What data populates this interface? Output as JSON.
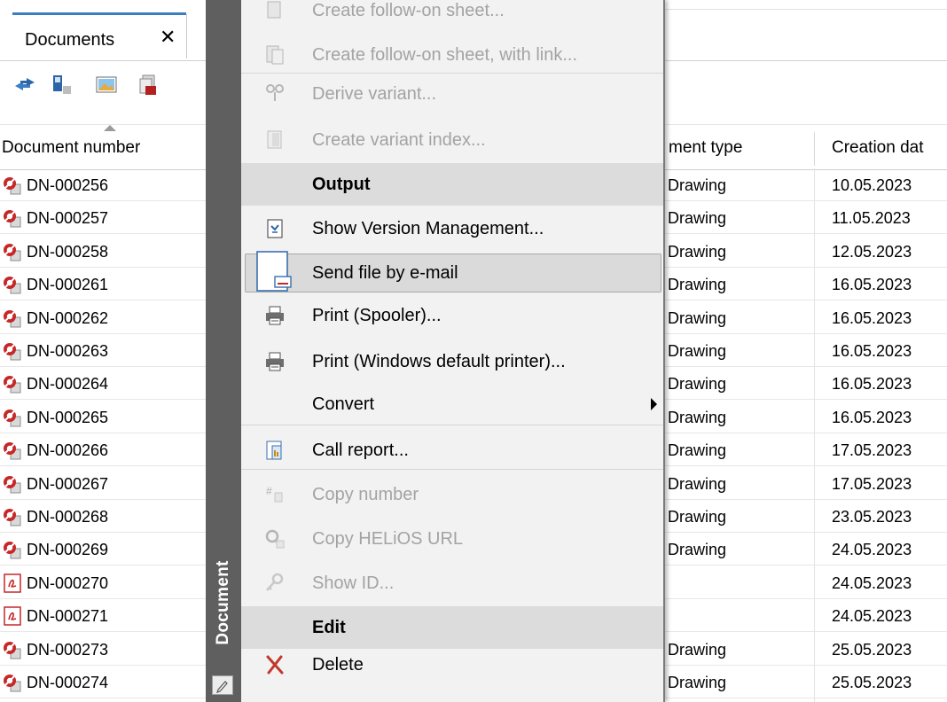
{
  "tab": {
    "title": "Documents",
    "close_glyph": "✕"
  },
  "toolbar": [
    {
      "icon": "refresh-icon"
    },
    {
      "icon": "document-status-icon"
    },
    {
      "icon": "image-preview-icon"
    },
    {
      "icon": "pdf-stack-icon"
    }
  ],
  "columns": {
    "document_number": "Document number",
    "document_type": "ment type",
    "creation_date": "Creation dat"
  },
  "rows": [
    {
      "number": "DN-000256",
      "type": ") Drawing",
      "date": "10.05.2023",
      "icon": "drawing-icon"
    },
    {
      "number": "DN-000257",
      "type": ") Drawing",
      "date": "11.05.2023",
      "icon": "drawing-icon"
    },
    {
      "number": "DN-000258",
      "type": ") Drawing",
      "date": "12.05.2023",
      "icon": "drawing-icon"
    },
    {
      "number": "DN-000261",
      "type": ") Drawing",
      "date": "16.05.2023",
      "icon": "drawing-icon"
    },
    {
      "number": "DN-000262",
      "type": ") Drawing",
      "date": "16.05.2023",
      "icon": "drawing-icon"
    },
    {
      "number": "DN-000263",
      "type": ") Drawing",
      "date": "16.05.2023",
      "icon": "drawing-icon"
    },
    {
      "number": "DN-000264",
      "type": ") Drawing",
      "date": "16.05.2023",
      "icon": "drawing-icon"
    },
    {
      "number": "DN-000265",
      "type": ") Drawing",
      "date": "16.05.2023",
      "icon": "drawing-icon"
    },
    {
      "number": "DN-000266",
      "type": ") Drawing",
      "date": "17.05.2023",
      "icon": "drawing-icon"
    },
    {
      "number": "DN-000267",
      "type": ") Drawing",
      "date": "17.05.2023",
      "icon": "drawing-icon"
    },
    {
      "number": "DN-000268",
      "type": ") Drawing",
      "date": "23.05.2023",
      "icon": "drawing-icon"
    },
    {
      "number": "DN-000269",
      "type": ") Drawing",
      "date": "24.05.2023",
      "icon": "drawing-icon"
    },
    {
      "number": "DN-000270",
      "type": "",
      "date": "24.05.2023",
      "icon": "pdf-icon"
    },
    {
      "number": "DN-000271",
      "type": "",
      "date": "24.05.2023",
      "icon": "pdf-icon"
    },
    {
      "number": "DN-000273",
      "type": ") Drawing",
      "date": "25.05.2023",
      "icon": "drawing-icon"
    },
    {
      "number": "DN-000274",
      "type": ") Drawing",
      "date": "25.05.2023",
      "icon": "drawing-icon"
    }
  ],
  "sidebar": {
    "label": "Document",
    "edit_icon": "pencil-icon"
  },
  "menu": {
    "items": [
      {
        "label": "Create follow-on sheet...",
        "icon": "follow-on-sheet-icon",
        "disabled": true
      },
      {
        "label": "Create follow-on sheet, with link...",
        "icon": "follow-on-sheet-link-icon",
        "disabled": true
      },
      {
        "label": "Derive variant...",
        "icon": "derive-variant-icon",
        "disabled": true
      },
      {
        "label": "Create variant index...",
        "icon": "variant-index-icon",
        "disabled": true
      },
      {
        "label": "Output",
        "header": true
      },
      {
        "label": "Show Version Management...",
        "icon": "version-management-icon"
      },
      {
        "label": "Send file by e-mail",
        "icon": "send-email-icon",
        "hover": true
      },
      {
        "label": "Print (Spooler)...",
        "icon": "printer-icon"
      },
      {
        "label": "Print (Windows default printer)...",
        "icon": "printer-icon"
      },
      {
        "label": "Convert",
        "submenu": true
      },
      {
        "label": "Call report...",
        "icon": "report-icon"
      },
      {
        "label": "Copy number",
        "icon": "copy-number-icon",
        "disabled": true
      },
      {
        "label": "Copy HELiOS URL",
        "icon": "copy-url-icon",
        "disabled": true
      },
      {
        "label": "Show ID...",
        "icon": "key-icon",
        "disabled": true
      },
      {
        "label": "Edit",
        "header": true
      },
      {
        "label": "Delete",
        "icon": "delete-icon"
      }
    ]
  },
  "colors": {
    "tab_accent": "#3c7fc1",
    "sidebar_bg": "#5f5f5f",
    "menu_bg": "#f2f2f2",
    "menu_header_bg": "#dcdcdc",
    "delete_red": "#c0392b"
  }
}
